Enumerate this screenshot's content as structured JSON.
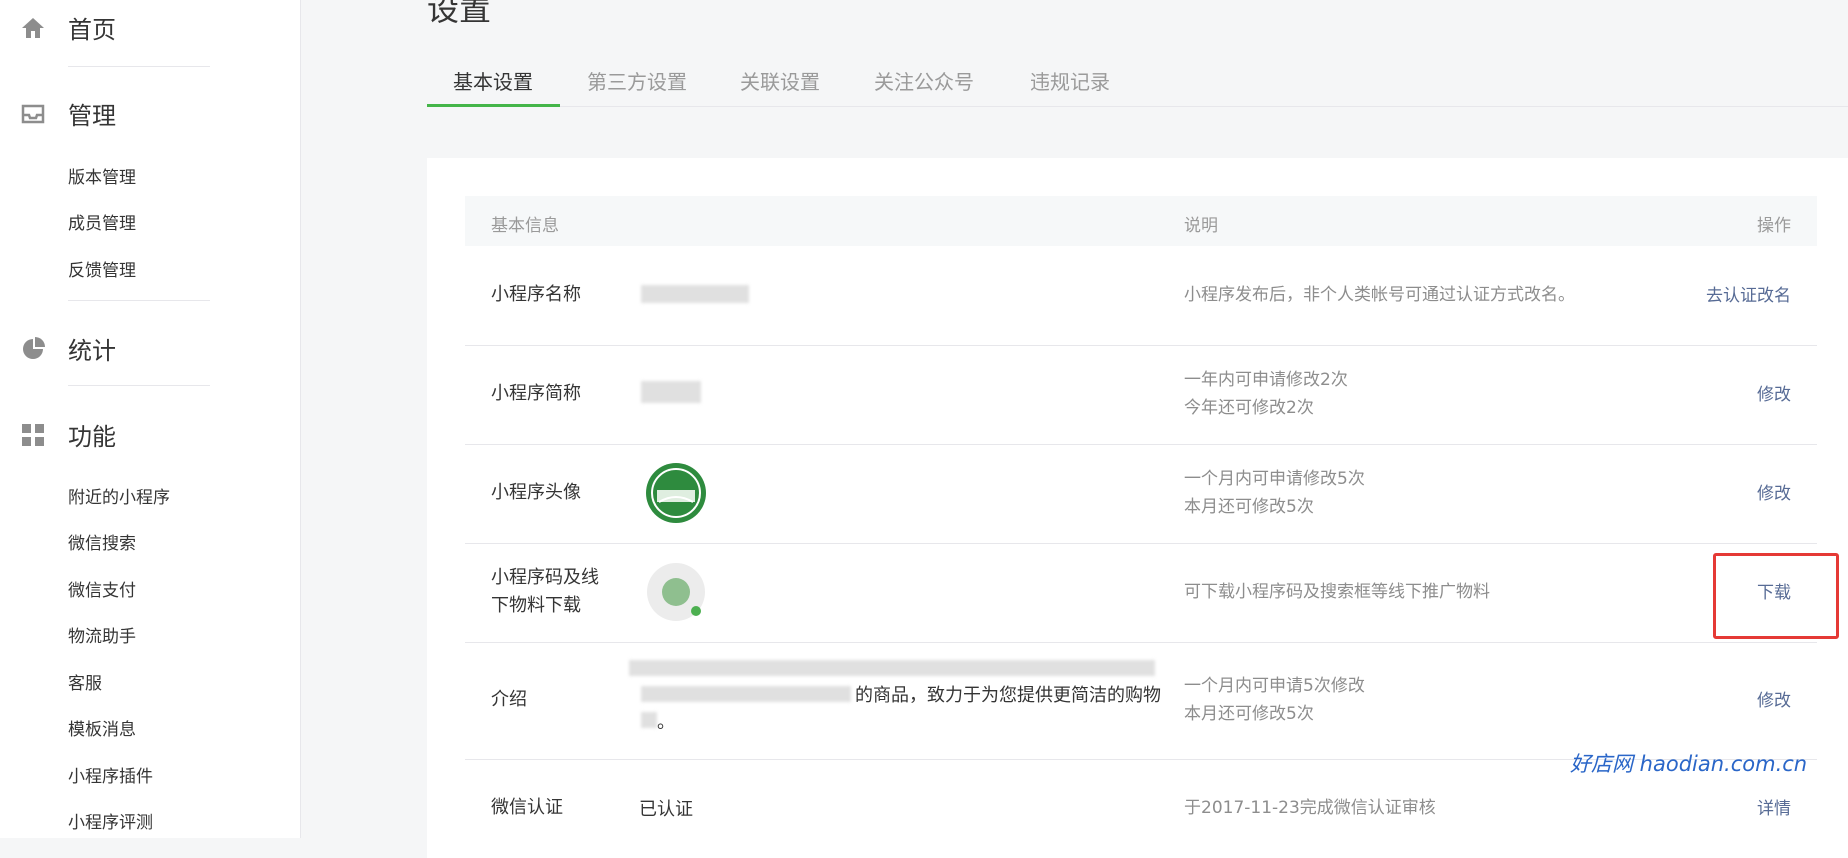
{
  "sidebar": {
    "home": "首页",
    "manage": "管理",
    "manage_items": [
      "版本管理",
      "成员管理",
      "反馈管理"
    ],
    "stats": "统计",
    "features": "功能",
    "feature_items": [
      "附近的小程序",
      "微信搜索",
      "微信支付",
      "物流助手",
      "客服",
      "模板消息",
      "小程序插件",
      "小程序评测"
    ]
  },
  "page": {
    "title": "设置",
    "tabs": [
      "基本设置",
      "第三方设置",
      "关联设置",
      "关注公众号",
      "违规记录"
    ],
    "active_tab_index": 0
  },
  "table": {
    "headers": {
      "info": "基本信息",
      "desc": "说明",
      "op": "操作"
    },
    "rows": [
      {
        "label": "小程序名称",
        "desc": [
          "小程序发布后，非个人类帐号可通过认证方式改名。"
        ],
        "op": "去认证改名"
      },
      {
        "label": "小程序简称",
        "desc": [
          "一年内可申请修改2次",
          "今年还可修改2次"
        ],
        "op": "修改"
      },
      {
        "label": "小程序头像",
        "desc": [
          "一个月内可申请修改5次",
          "本月还可修改5次"
        ],
        "op": "修改"
      },
      {
        "label": [
          "小程序码及线",
          "下物料下载"
        ],
        "desc": [
          "可下载小程序码及搜索框等线下推广物料"
        ],
        "op": "下载"
      },
      {
        "label": "介绍",
        "value_fragment": "的商品，致力于为您提供更简洁的购物",
        "value_end": "。",
        "desc": [
          "一个月内可申请5次修改",
          "本月还可修改5次"
        ],
        "op": "修改"
      },
      {
        "label": "微信认证",
        "value": "已认证",
        "desc": [
          "于2017-11-23完成微信认证审核"
        ],
        "op": "详情"
      }
    ]
  },
  "watermark": "好店网 haodian.com.cn",
  "colors": {
    "accent": "#44b549",
    "link": "#576b95",
    "highlight": "#e53935"
  }
}
